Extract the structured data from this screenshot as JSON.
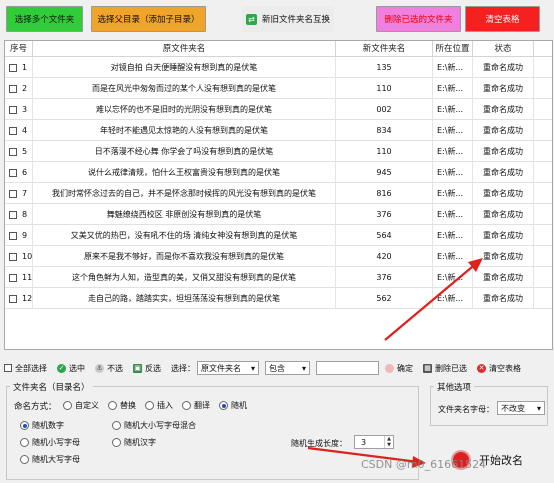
{
  "toolbar": {
    "select_folders": "选择多个文件夹",
    "select_parent": "选择父目录（添加子目录）",
    "swap_names": "新旧文件夹名互换",
    "remove_selected": "删除已选的文件夹",
    "clear_table": "清空表格"
  },
  "table": {
    "headers": [
      "序号",
      "原文件夹名",
      "新文件夹名",
      "所在位置",
      "状态"
    ],
    "rows": [
      {
        "no": "1",
        "orig": "对镜自拍 白天便睡醒没有想到真的是伏笔",
        "new": "135",
        "loc": "E:\\新...",
        "status": "重命名成功"
      },
      {
        "no": "2",
        "orig": "而是在风光中匆匆而过的某个人没有想到真的是伏笔",
        "new": "110",
        "loc": "E:\\新...",
        "status": "重命名成功"
      },
      {
        "no": "3",
        "orig": "难以忘怀的也不是旧时的光阴没有想到真的是伏笔",
        "new": "002",
        "loc": "E:\\新...",
        "status": "重命名成功"
      },
      {
        "no": "4",
        "orig": "年轻时不能遇见太惊艳的人没有想到真的是伏笔",
        "new": "834",
        "loc": "E:\\新...",
        "status": "重命名成功"
      },
      {
        "no": "5",
        "orig": "日不落漫不经心舞 你学会了吗没有想到真的是伏笔",
        "new": "110",
        "loc": "E:\\新...",
        "status": "重命名成功"
      },
      {
        "no": "6",
        "orig": "说什么戒律清规，怕什么王权富贵没有想到真的是伏笔",
        "new": "945",
        "loc": "E:\\新...",
        "status": "重命名成功"
      },
      {
        "no": "7",
        "orig": "我们时常怀念过去的自己，并不是怀念那时候挥的风光没有想到真的是伏笔",
        "new": "816",
        "loc": "E:\\新...",
        "status": "重命名成功"
      },
      {
        "no": "8",
        "orig": "舞魅缭绕西校区 非原创没有想到真的是伏笔",
        "new": "376",
        "loc": "E:\\新...",
        "status": "重命名成功"
      },
      {
        "no": "9",
        "orig": "又美又优的热巴，没有吼不住的场 清纯女神没有想到真的是伏笔",
        "new": "564",
        "loc": "E:\\新...",
        "status": "重命名成功"
      },
      {
        "no": "10",
        "orig": "原来不是我不够好，而是你不喜欢我没有想到真的是伏笔",
        "new": "420",
        "loc": "E:\\新...",
        "status": "重命名成功"
      },
      {
        "no": "11",
        "orig": "这个角色鲜为人知，造型真的美，又俏又甜没有想到真的是伏笔",
        "new": "376",
        "loc": "E:\\新...",
        "status": "重命名成功"
      },
      {
        "no": "12",
        "orig": "走自己的路，踏踏实实，坦坦荡荡没有想到真的是伏笔",
        "new": "562",
        "loc": "E:\\新...",
        "status": "重命名成功"
      }
    ]
  },
  "bottombar": {
    "select_all": "全部选择",
    "select_checked": "选中",
    "deselect": "不选",
    "invert": "反选",
    "choose_label": "选择：",
    "field_select": "原文件夹名",
    "match_select": "包含",
    "filter_value": "",
    "confirm": "确定",
    "delete_checked": "删除已选",
    "clear_table": "清空表格"
  },
  "naming": {
    "group_title": "文件夹名（目录名）",
    "method_label": "命名方式：",
    "methods": [
      "自定义",
      "替换",
      "插入",
      "翻译",
      "随机"
    ],
    "selected_method": "随机",
    "random_options": [
      "随机数字",
      "随机大小写字母混合",
      "随机小写字母",
      "随机汉字",
      "随机大写字母"
    ],
    "selected_random": "随机数字",
    "length_label": "随机生成长度：",
    "length_value": "3"
  },
  "other": {
    "group_title": "其他选项",
    "case_label": "文件夹名字母：",
    "case_value": "不改变"
  },
  "start_button": "开始改名",
  "watermark": "CSDN @m0_61661524"
}
